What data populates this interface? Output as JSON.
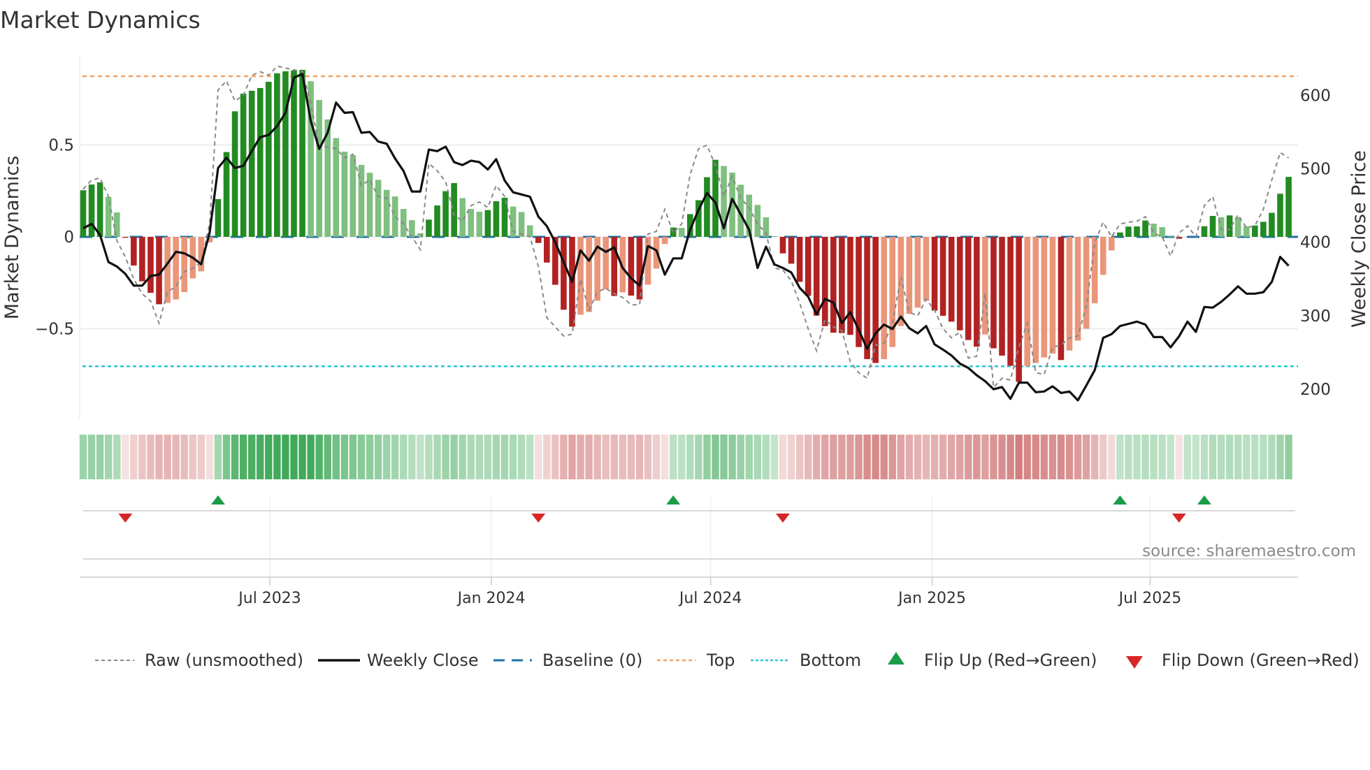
{
  "chart_data": {
    "type": "bar",
    "title": "Market Dynamics",
    "ylabel": "Market Dynamics",
    "y2label": "Weekly Close Price",
    "source": "source: sharemaestro.com",
    "start_week": "2023-01-27",
    "frequency": "weekly",
    "ylim": [
      -0.98,
      0.99
    ],
    "y2lim": [
      170,
      660
    ],
    "yticks": [
      {
        "v": 0.5,
        "label": "0.5"
      },
      {
        "v": 0,
        "label": "0"
      },
      {
        "v": -0.5,
        "label": "−0.5"
      }
    ],
    "y2ticks": [
      {
        "v": 600,
        "label": "600"
      },
      {
        "v": 500,
        "label": "500"
      },
      {
        "v": 400,
        "label": "400"
      },
      {
        "v": 300,
        "label": "300"
      },
      {
        "v": 200,
        "label": "200"
      }
    ],
    "xticks": [
      {
        "date": "2023-07-01",
        "label": "Jul 2023"
      },
      {
        "date": "2024-01-01",
        "label": "Jan 2024"
      },
      {
        "date": "2024-07-01",
        "label": "Jul 2024"
      },
      {
        "date": "2025-01-01",
        "label": "Jan 2025"
      },
      {
        "date": "2025-07-01",
        "label": "Jul 2025"
      }
    ],
    "top_level": 0.875,
    "bottom_level": -0.705,
    "baseline": 0,
    "dynamics": [
      0.254,
      0.285,
      0.297,
      0.218,
      0.133,
      -0.005,
      -0.156,
      -0.242,
      -0.305,
      -0.367,
      -0.36,
      -0.341,
      -0.301,
      -0.226,
      -0.188,
      -0.03,
      0.206,
      0.462,
      0.684,
      0.78,
      0.796,
      0.811,
      0.845,
      0.891,
      0.902,
      0.907,
      0.91,
      0.848,
      0.746,
      0.64,
      0.538,
      0.464,
      0.444,
      0.392,
      0.349,
      0.311,
      0.256,
      0.22,
      0.152,
      0.091,
      0.019,
      0.094,
      0.171,
      0.249,
      0.293,
      0.211,
      0.152,
      0.137,
      0.146,
      0.194,
      0.213,
      0.165,
      0.135,
      0.063,
      -0.033,
      -0.14,
      -0.261,
      -0.397,
      -0.489,
      -0.424,
      -0.409,
      -0.348,
      -0.287,
      -0.322,
      -0.302,
      -0.32,
      -0.341,
      -0.261,
      -0.173,
      -0.039,
      0.051,
      0.049,
      0.124,
      0.2,
      0.325,
      0.42,
      0.386,
      0.35,
      0.284,
      0.23,
      0.174,
      0.107,
      0.004,
      -0.09,
      -0.146,
      -0.245,
      -0.321,
      -0.429,
      -0.486,
      -0.522,
      -0.524,
      -0.534,
      -0.6,
      -0.666,
      -0.687,
      -0.666,
      -0.6,
      -0.486,
      -0.42,
      -0.385,
      -0.348,
      -0.402,
      -0.43,
      -0.462,
      -0.509,
      -0.562,
      -0.598,
      -0.532,
      -0.607,
      -0.647,
      -0.702,
      -0.79,
      -0.704,
      -0.687,
      -0.657,
      -0.636,
      -0.671,
      -0.619,
      -0.565,
      -0.501,
      -0.362,
      -0.207,
      -0.074,
      0.024,
      0.056,
      0.057,
      0.089,
      0.072,
      0.053,
      0.004,
      -0.01,
      0.0,
      0.0,
      0.058,
      0.114,
      0.107,
      0.117,
      0.107,
      0.058,
      0.062,
      0.082,
      0.131,
      0.235,
      0.327
    ],
    "raw": [
      0.26,
      0.31,
      0.32,
      0.22,
      -0.02,
      -0.11,
      -0.23,
      -0.31,
      -0.35,
      -0.47,
      -0.3,
      -0.27,
      -0.19,
      -0.17,
      -0.14,
      0.07,
      0.8,
      0.85,
      0.74,
      0.77,
      0.88,
      0.9,
      0.88,
      0.93,
      0.92,
      0.91,
      0.9,
      0.73,
      0.49,
      0.49,
      0.48,
      0.43,
      0.45,
      0.28,
      0.31,
      0.22,
      0.21,
      0.11,
      0.07,
      0.0,
      -0.07,
      0.4,
      0.36,
      0.3,
      0.12,
      0.085,
      0.17,
      0.19,
      0.16,
      0.28,
      0.22,
      0.03,
      0.015,
      0.0,
      -0.16,
      -0.44,
      -0.49,
      -0.54,
      -0.53,
      -0.23,
      -0.4,
      -0.3,
      -0.28,
      -0.31,
      -0.33,
      -0.37,
      -0.37,
      0.015,
      0.03,
      0.15,
      0.02,
      0.07,
      0.34,
      0.48,
      0.5,
      0.39,
      0.22,
      0.33,
      0.21,
      0.16,
      0.07,
      0.02,
      -0.17,
      -0.18,
      -0.24,
      -0.36,
      -0.5,
      -0.62,
      -0.45,
      -0.49,
      -0.51,
      -0.68,
      -0.74,
      -0.77,
      -0.59,
      -0.58,
      -0.47,
      -0.22,
      -0.41,
      -0.43,
      -0.34,
      -0.4,
      -0.5,
      -0.55,
      -0.52,
      -0.66,
      -0.65,
      -0.31,
      -0.82,
      -0.77,
      -0.78,
      -0.6,
      -0.47,
      -0.74,
      -0.75,
      -0.6,
      -0.59,
      -0.55,
      -0.54,
      -0.38,
      -0.03,
      0.08,
      0.0,
      0.07,
      0.08,
      0.085,
      0.11,
      0.02,
      0.0,
      -0.105,
      0.02,
      0.06,
      0.0,
      0.17,
      0.22,
      0.04,
      0.04,
      0.12,
      0.05,
      0.06,
      0.15,
      0.31,
      0.46,
      0.43
    ],
    "weekly_close": [
      419,
      425,
      410,
      373,
      367,
      357,
      341,
      341,
      354,
      356,
      371,
      387,
      385,
      379,
      370,
      413,
      501,
      515,
      501,
      504,
      524,
      543,
      546,
      558,
      576,
      624,
      629,
      565,
      527,
      549,
      590,
      576,
      577,
      549,
      550,
      537,
      534,
      514,
      497,
      469,
      469,
      526,
      524,
      530,
      509,
      505,
      511,
      509,
      499,
      513,
      484,
      468,
      465,
      462,
      435,
      422,
      400,
      373,
      346,
      389,
      375,
      394,
      387,
      393,
      365,
      351,
      341,
      395,
      389,
      356,
      378,
      378,
      417,
      444,
      467,
      454,
      419,
      459,
      438,
      417,
      365,
      394,
      370,
      365,
      359,
      338,
      326,
      302,
      323,
      318,
      290,
      305,
      281,
      255,
      276,
      288,
      282,
      299,
      283,
      276,
      286,
      261,
      254,
      246,
      235,
      229,
      219,
      211,
      200,
      203,
      187,
      209,
      209,
      196,
      197,
      204,
      195,
      197,
      185,
      205,
      226,
      270,
      275,
      286,
      289,
      292,
      288,
      271,
      271,
      257,
      272,
      292,
      278,
      312,
      311,
      319,
      329,
      340,
      330,
      330,
      332,
      346,
      380,
      368
    ],
    "flip_up_weeks": [
      16,
      70,
      123,
      133
    ],
    "flip_down_weeks": [
      5,
      54,
      83,
      130
    ],
    "legend": {
      "placement": "bottom",
      "raw": "Raw (unsmoothed)",
      "close": "Weekly Close",
      "baseline": "Baseline (0)",
      "top": "Top",
      "bottom": "Bottom",
      "flip_up": "Flip Up (Red→Green)",
      "flip_down": "Flip Down (Green→Red)"
    },
    "colors": {
      "up_strong": "#228b22",
      "up_weak": "#7fbf7f",
      "down_strong": "#b22222",
      "down_weak": "#e9967a",
      "baseline": "#1f6fa8",
      "top": "#f4a261",
      "bottom": "#2ec4d6",
      "raw": "#888888",
      "close": "#111111",
      "flip_up": "#1a9c46",
      "flip_down": "#d62728"
    }
  }
}
